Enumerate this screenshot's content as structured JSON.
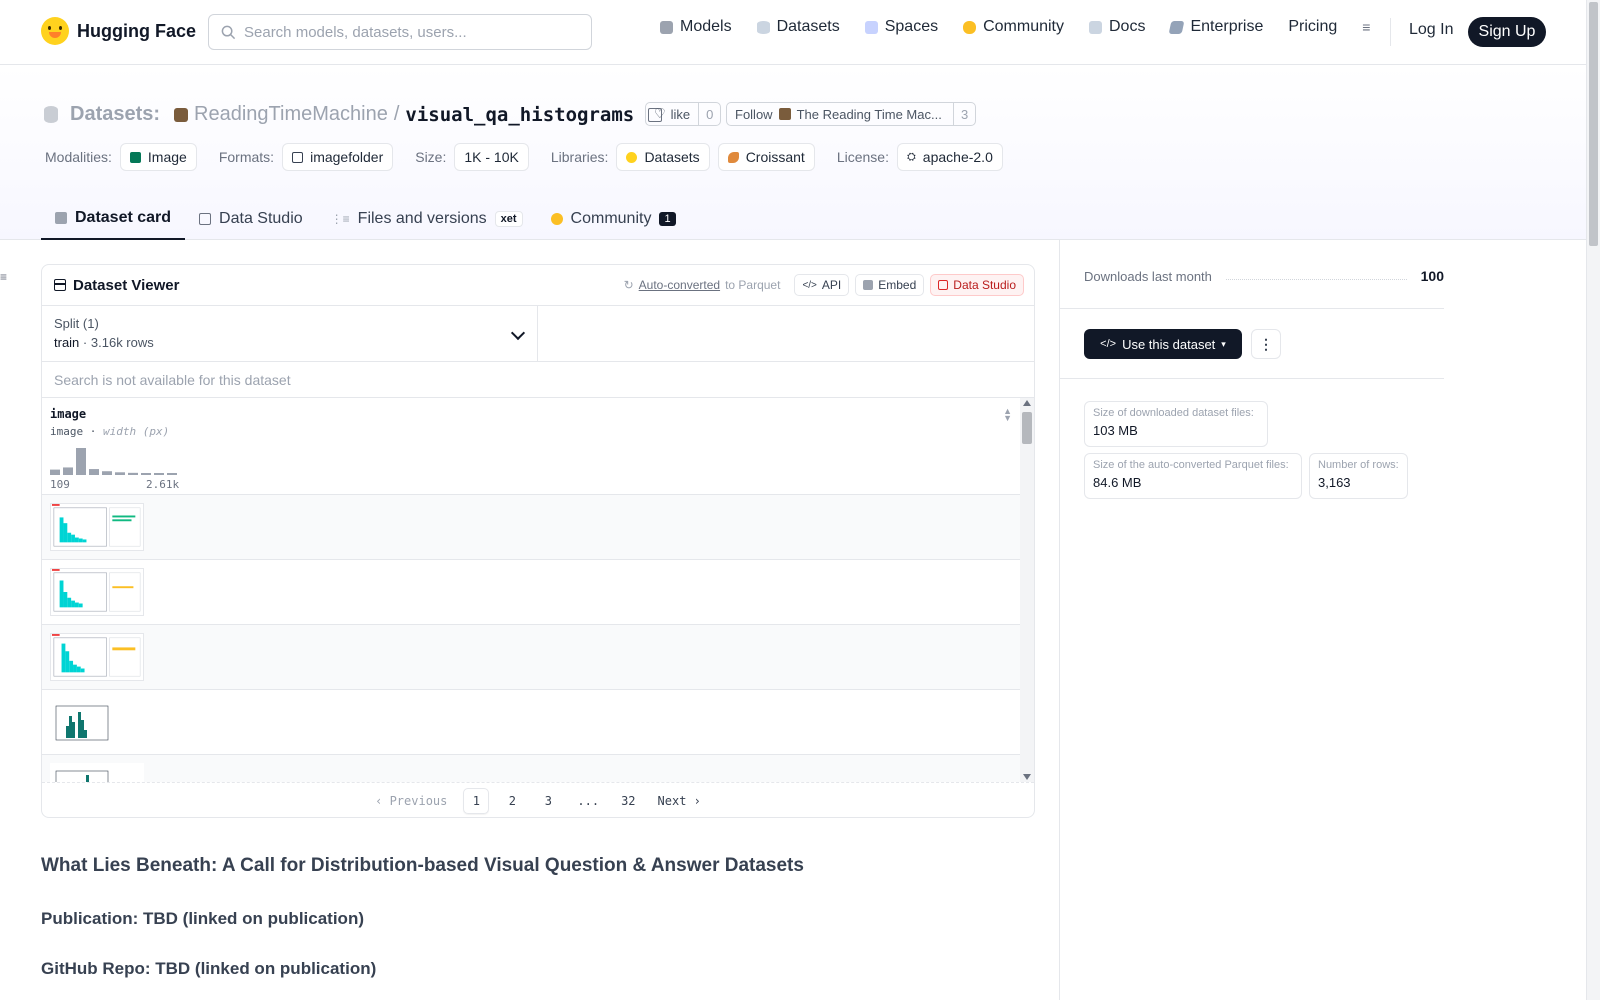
{
  "header": {
    "brand": "Hugging Face",
    "search_placeholder": "Search models, datasets, users...",
    "nav": [
      {
        "label": "Models",
        "icon": "models-icon",
        "color": "#9ca3af"
      },
      {
        "label": "Datasets",
        "icon": "datasets-icon",
        "color": "#cbd5e1"
      },
      {
        "label": "Spaces",
        "icon": "spaces-icon",
        "color": "#c7d2fe"
      },
      {
        "label": "Community",
        "icon": "community-icon",
        "color": "#fbbf24"
      },
      {
        "label": "Docs",
        "icon": "docs-icon",
        "color": "#cbd5e1"
      },
      {
        "label": "Enterprise",
        "icon": "enterprise-icon",
        "color": "#94a3b8"
      },
      {
        "label": "Pricing"
      }
    ],
    "login": "Log In",
    "signup": "Sign Up"
  },
  "repo": {
    "type_label": "Datasets:",
    "owner": "ReadingTimeMachine",
    "separator": "/",
    "name": "visual_qa_histograms",
    "like_label": "like",
    "like_count": "0",
    "follow_label": "Follow",
    "follow_org": "The Reading Time Mac...",
    "follow_count": "3"
  },
  "meta": {
    "modalities_label": "Modalities:",
    "modality": "Image",
    "formats_label": "Formats:",
    "format": "imagefolder",
    "size_label": "Size:",
    "size": "1K - 10K",
    "libraries_label": "Libraries:",
    "libraries": [
      "Datasets",
      "Croissant"
    ],
    "license_label": "License:",
    "license": "apache-2.0"
  },
  "tabs": [
    {
      "label": "Dataset card",
      "active": true
    },
    {
      "label": "Data Studio"
    },
    {
      "label": "Files and versions",
      "badge": "xet"
    },
    {
      "label": "Community",
      "count": "1"
    }
  ],
  "viewer": {
    "title": "Dataset Viewer",
    "auto_converted": "Auto-converted",
    "to_parquet": "to Parquet",
    "api": "API",
    "embed": "Embed",
    "data_studio": "Data Studio",
    "split_label": "Split (1)",
    "split_name": "train",
    "split_dot": "·",
    "split_rows": "3.16k rows",
    "search_na": "Search is not available for this dataset",
    "column": {
      "name": "image",
      "type": "image",
      "type_sep": "·",
      "subtype": "width (px)",
      "min": "109",
      "max": "2.61k",
      "histogram": [
        0.2,
        0.28,
        1.0,
        0.22,
        0.14,
        0.1,
        0.08,
        0.06,
        0.03,
        0.05
      ]
    },
    "pager": {
      "prev": "Previous",
      "pages": [
        "1",
        "2",
        "3",
        "...",
        "32"
      ],
      "current": "1",
      "next": "Next"
    }
  },
  "card": {
    "title": "What Lies Beneath: A Call for Distribution-based Visual Question & Answer Datasets",
    "publication": "Publication: TBD (linked on publication)",
    "github": "GitHub Repo: TBD (linked on publication)"
  },
  "sidebar": {
    "downloads_label": "Downloads last month",
    "downloads_value": "100",
    "use_dataset": "Use this dataset",
    "size_dl_label": "Size of downloaded dataset files:",
    "size_dl_value": "103 MB",
    "size_parquet_label": "Size of the auto-converted Parquet files:",
    "size_parquet_value": "84.6 MB",
    "rows_label": "Number of rows:",
    "rows_value": "3,163"
  }
}
